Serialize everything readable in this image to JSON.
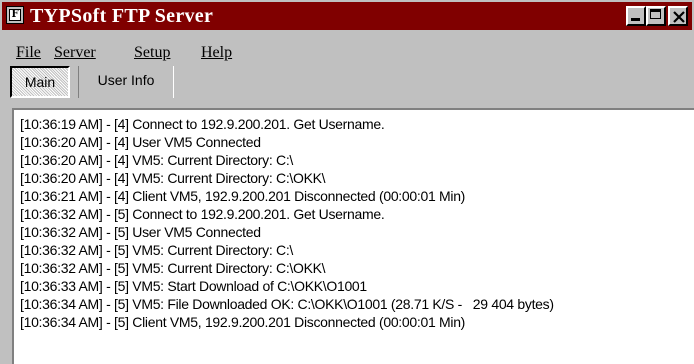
{
  "window": {
    "title": "TYPSoft FTP Server",
    "icon_glyph": "F"
  },
  "menu": {
    "file": "File",
    "server": "Server",
    "setup": "Setup",
    "help": "Help"
  },
  "tabs": {
    "main": "Main",
    "user_info": "User Info"
  },
  "log": [
    "[10:36:19 AM] - [4] Connect to 192.9.200.201. Get Username.",
    "[10:36:20 AM] - [4] User VM5 Connected",
    "[10:36:20 AM] - [4] VM5: Current Directory: C:\\",
    "[10:36:20 AM] - [4] VM5: Current Directory: C:\\OKK\\",
    "[10:36:21 AM] - [4] Client VM5, 192.9.200.201 Disconnected (00:00:01 Min)",
    "[10:36:32 AM] - [5] Connect to 192.9.200.201. Get Username.",
    "[10:36:32 AM] - [5] User VM5 Connected",
    "[10:36:32 AM] - [5] VM5: Current Directory: C:\\",
    "[10:36:32 AM] - [5] VM5: Current Directory: C:\\OKK\\",
    "[10:36:33 AM] - [5] VM5: Start Download of C:\\OKK\\O1001",
    "[10:36:34 AM] - [5] VM5: File Downloaded OK: C:\\OKK\\O1001 (28.71 K/S -   29 404 bytes)",
    "[10:36:34 AM] - [5] Client VM5, 192.9.200.201 Disconnected (00:00:01 Min)"
  ]
}
